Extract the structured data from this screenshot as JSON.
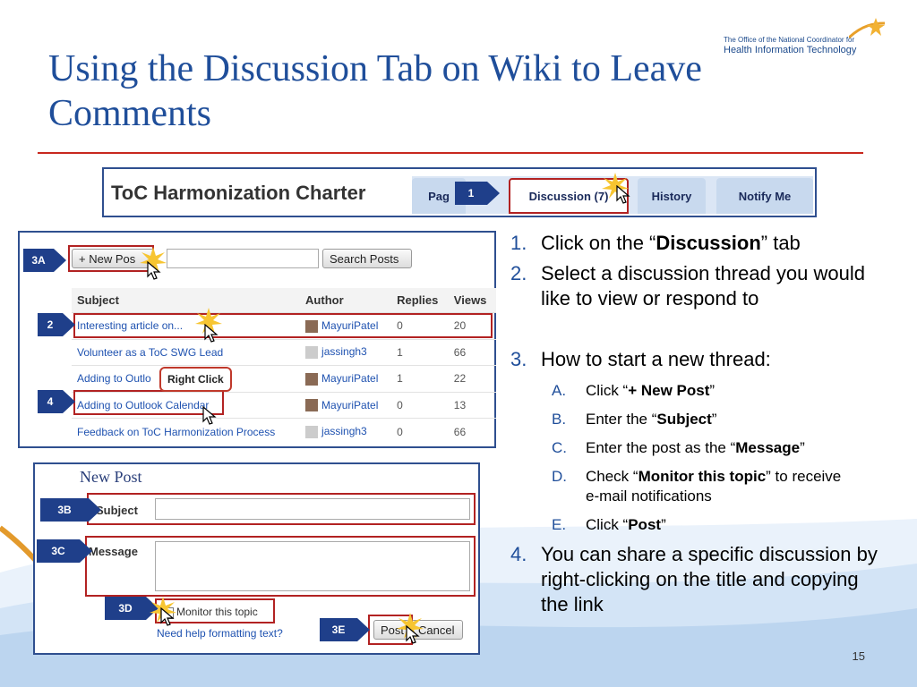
{
  "slide": {
    "title": "Using the Discussion Tab on Wiki to Leave Comments",
    "page_number": "15",
    "logo_line1": "The Office of the National Coordinator for",
    "logo_line2": "Health Information Technology"
  },
  "wiki_header": {
    "page_title": "ToC Harmonization Charter",
    "tabs": [
      "Pag",
      "Discussion (7)",
      "History",
      "Notify Me"
    ],
    "callout": "1"
  },
  "posts": {
    "new_post_label": "+ New Pos",
    "search_label": "Search Posts",
    "columns": [
      "Subject",
      "Author",
      "Replies",
      "Views"
    ],
    "rows": [
      {
        "subject": "Interesting article on...",
        "author": "MayuriPatel",
        "replies": "0",
        "views": "20"
      },
      {
        "subject": "Volunteer as a ToC SWG Lead",
        "author": "jassingh3",
        "replies": "1",
        "views": "66"
      },
      {
        "subject": "Adding to Outlo",
        "author": "MayuriPatel",
        "replies": "1",
        "views": "22"
      },
      {
        "subject": "Adding to Outlook Calendar",
        "author": "MayuriPatel",
        "replies": "0",
        "views": "13"
      },
      {
        "subject": "Feedback on ToC Harmonization Process",
        "author": "jassingh3",
        "replies": "0",
        "views": "66"
      }
    ],
    "right_click_label": "Right Click",
    "callouts": [
      "3A",
      "2",
      "4"
    ]
  },
  "new_post": {
    "heading": "New Post",
    "subject_label": "Subject",
    "message_label": "Message",
    "monitor_label": "Monitor this topic",
    "help_link": "Need help formatting text?",
    "post_button": "Post",
    "cancel_button": "Cancel",
    "callouts": [
      "3B",
      "3C",
      "3D",
      "3E"
    ]
  },
  "instructions": {
    "item1": {
      "num": "1.",
      "pre": "Click on the “",
      "bold": "Discussion",
      "post": "” tab"
    },
    "item2": {
      "num": "2.",
      "text": "Select a discussion thread you would like to view or respond to"
    },
    "item3": {
      "num": "3.",
      "text": "How to start a new thread:"
    },
    "subA": {
      "num": "A.",
      "pre": "Click “",
      "bold": "+ New Post",
      "post": "”"
    },
    "subB": {
      "num": "B.",
      "pre": "Enter the “",
      "bold": "Subject",
      "post": "”"
    },
    "subC": {
      "num": "C.",
      "pre": "Enter the post as the “",
      "bold": "Message",
      "post": "”"
    },
    "subD": {
      "num": "D.",
      "pre": "Check “",
      "bold": "Monitor this topic",
      "post": "” to receive e-mail notifications"
    },
    "subE": {
      "num": "E.",
      "pre": "Click “",
      "bold": "Post",
      "post": "”"
    },
    "item4": {
      "num": "4.",
      "text": "You can share a specific discussion by right-clicking on the title and copying the link"
    }
  },
  "colors": {
    "title": "#1f4e9a",
    "rule": "#c8281e",
    "callout": "#1f3f8a",
    "highlight": "#b22222"
  }
}
